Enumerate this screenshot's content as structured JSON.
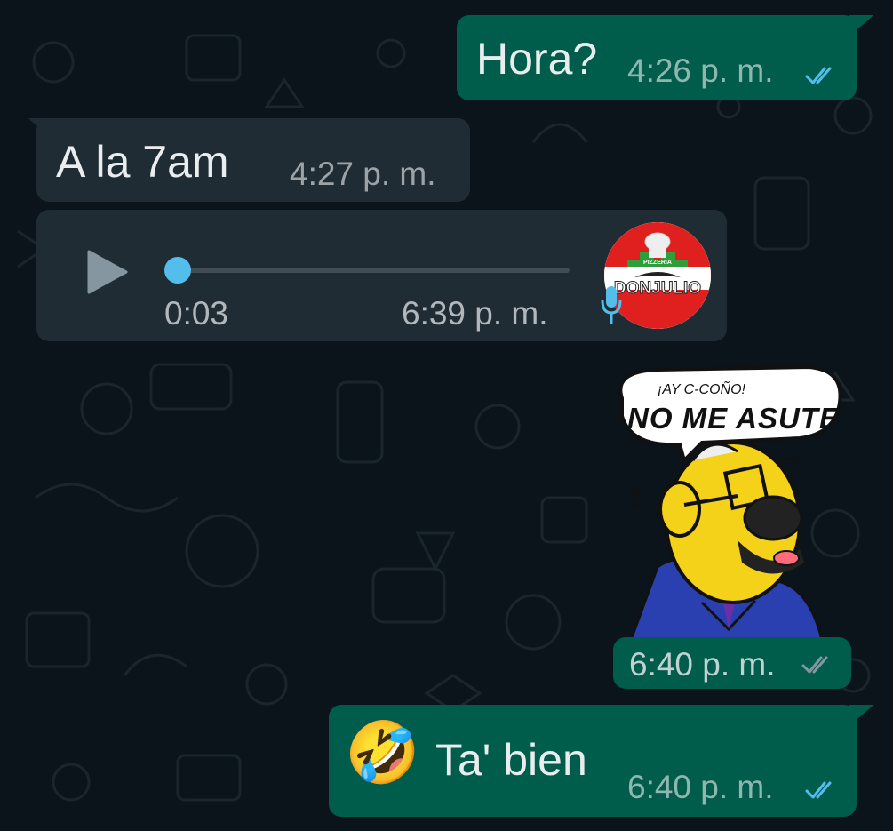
{
  "messages": [
    {
      "direction": "outgoing",
      "text": "Hora?",
      "time": "4:26 p. m.",
      "status": "read"
    },
    {
      "direction": "incoming",
      "text": "A la 7am",
      "time": "4:27 p. m."
    },
    {
      "direction": "incoming",
      "type": "voice",
      "duration": "0:03",
      "time": "6:39 p. m.",
      "progress": 0,
      "avatar_text": "DONJULIO",
      "avatar_top_text": "PIZZERIA"
    },
    {
      "direction": "outgoing",
      "type": "sticker",
      "sticker_line1": "¡AY C-COÑO!",
      "sticker_line2": "NO ME ASUTE",
      "time": "6:40 p. m.",
      "status": "delivered"
    },
    {
      "direction": "outgoing",
      "emoji": "🤣",
      "text": "Ta' bien",
      "time": "6:40 p. m.",
      "status": "read"
    }
  ],
  "colors": {
    "background": "#0b141a",
    "outgoing_bubble": "#005c4b",
    "incoming_bubble": "#202c33",
    "read_tick": "#53bdeb",
    "delivered_tick": "#8696a0",
    "voice_knob": "#53bdeb",
    "mic_icon": "#53bdeb"
  },
  "icons": [
    "play-icon",
    "mic-icon",
    "double-check-icon",
    "laughing-emoji-icon"
  ]
}
